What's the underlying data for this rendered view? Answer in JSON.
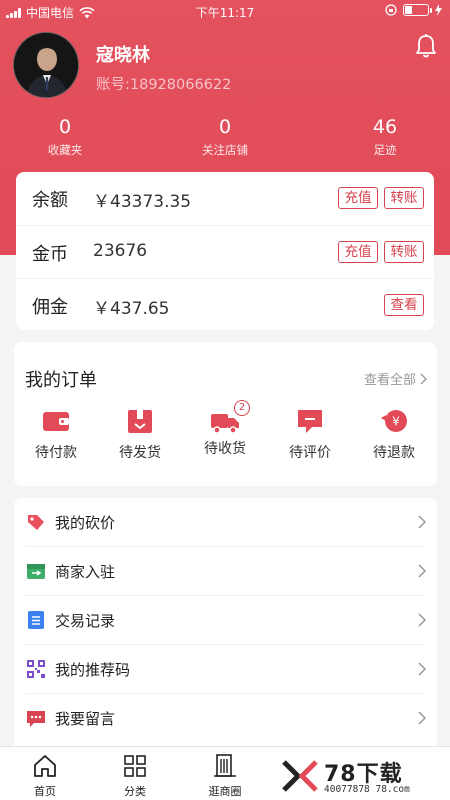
{
  "status_bar": {
    "carrier": "中国电信",
    "time": "下午11:17"
  },
  "profile": {
    "name": "寇晓林",
    "account": "账号:18928066622"
  },
  "stats": [
    {
      "value": "0",
      "label": "收藏夹"
    },
    {
      "value": "0",
      "label": "关注店铺"
    },
    {
      "value": "46",
      "label": "足迹"
    }
  ],
  "wallet": {
    "balance": {
      "label": "余额",
      "value": "￥43373.35",
      "btn1": "充值",
      "btn2": "转账"
    },
    "coins": {
      "label": "金币",
      "value": "23676",
      "btn1": "充值",
      "btn2": "转账"
    },
    "commission": {
      "label": "佣金",
      "value": "￥437.65",
      "btn1": "查看"
    }
  },
  "orders": {
    "title": "我的订单",
    "view_all": "查看全部",
    "items": [
      {
        "label": "待付款",
        "icon": "wallet-icon"
      },
      {
        "label": "待发货",
        "icon": "package-icon"
      },
      {
        "label": "待收货",
        "icon": "truck-icon",
        "badge": "2"
      },
      {
        "label": "待评价",
        "icon": "comment-icon"
      },
      {
        "label": "待退款",
        "icon": "refund-icon"
      }
    ]
  },
  "menu": [
    {
      "label": "我的砍价",
      "icon": "tag-icon",
      "color": "#e8505b"
    },
    {
      "label": "商家入驻",
      "icon": "store-icon",
      "color": "#3fae6a"
    },
    {
      "label": "交易记录",
      "icon": "list-icon",
      "color": "#3b82f0"
    },
    {
      "label": "我的推荐码",
      "icon": "qrcode-icon",
      "color": "#7c4dcc"
    },
    {
      "label": "我要留言",
      "icon": "message-icon",
      "color": "#d9434f"
    }
  ],
  "tabs": [
    {
      "label": "首页",
      "icon": "home-icon"
    },
    {
      "label": "分类",
      "icon": "grid-icon"
    },
    {
      "label": "逛商圈",
      "icon": "building-icon"
    }
  ],
  "watermark": {
    "brand": "78下载",
    "url": "40077878 78.com"
  },
  "colors": {
    "primary": "#e24a57",
    "accent_border": "#d9434f",
    "background": "#f4f4f4"
  }
}
